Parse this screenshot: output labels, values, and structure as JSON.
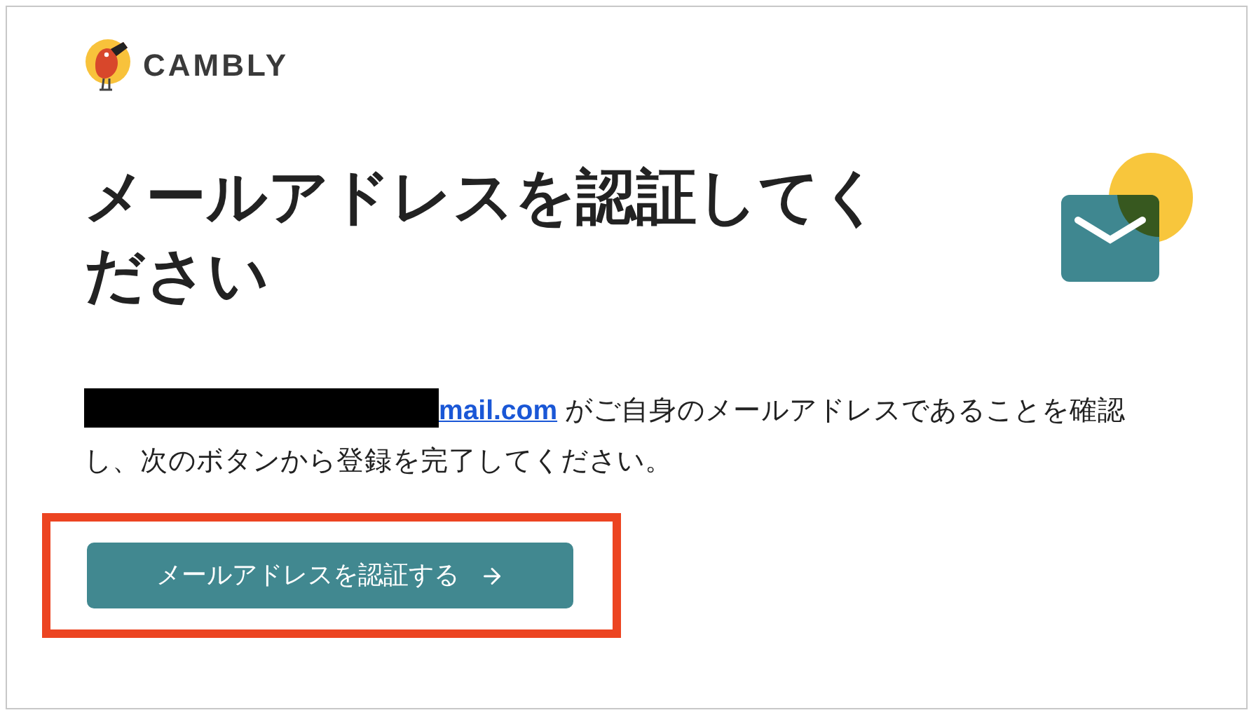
{
  "logo": {
    "text": "CAMBLY"
  },
  "heading": "メールアドレスを認証してください",
  "message": {
    "email_link": "mail.com",
    "text": " がご自身のメールアドレスであることを確認し、次のボタンから登録を完了してください。"
  },
  "button": {
    "label": "メールアドレスを認証する"
  }
}
